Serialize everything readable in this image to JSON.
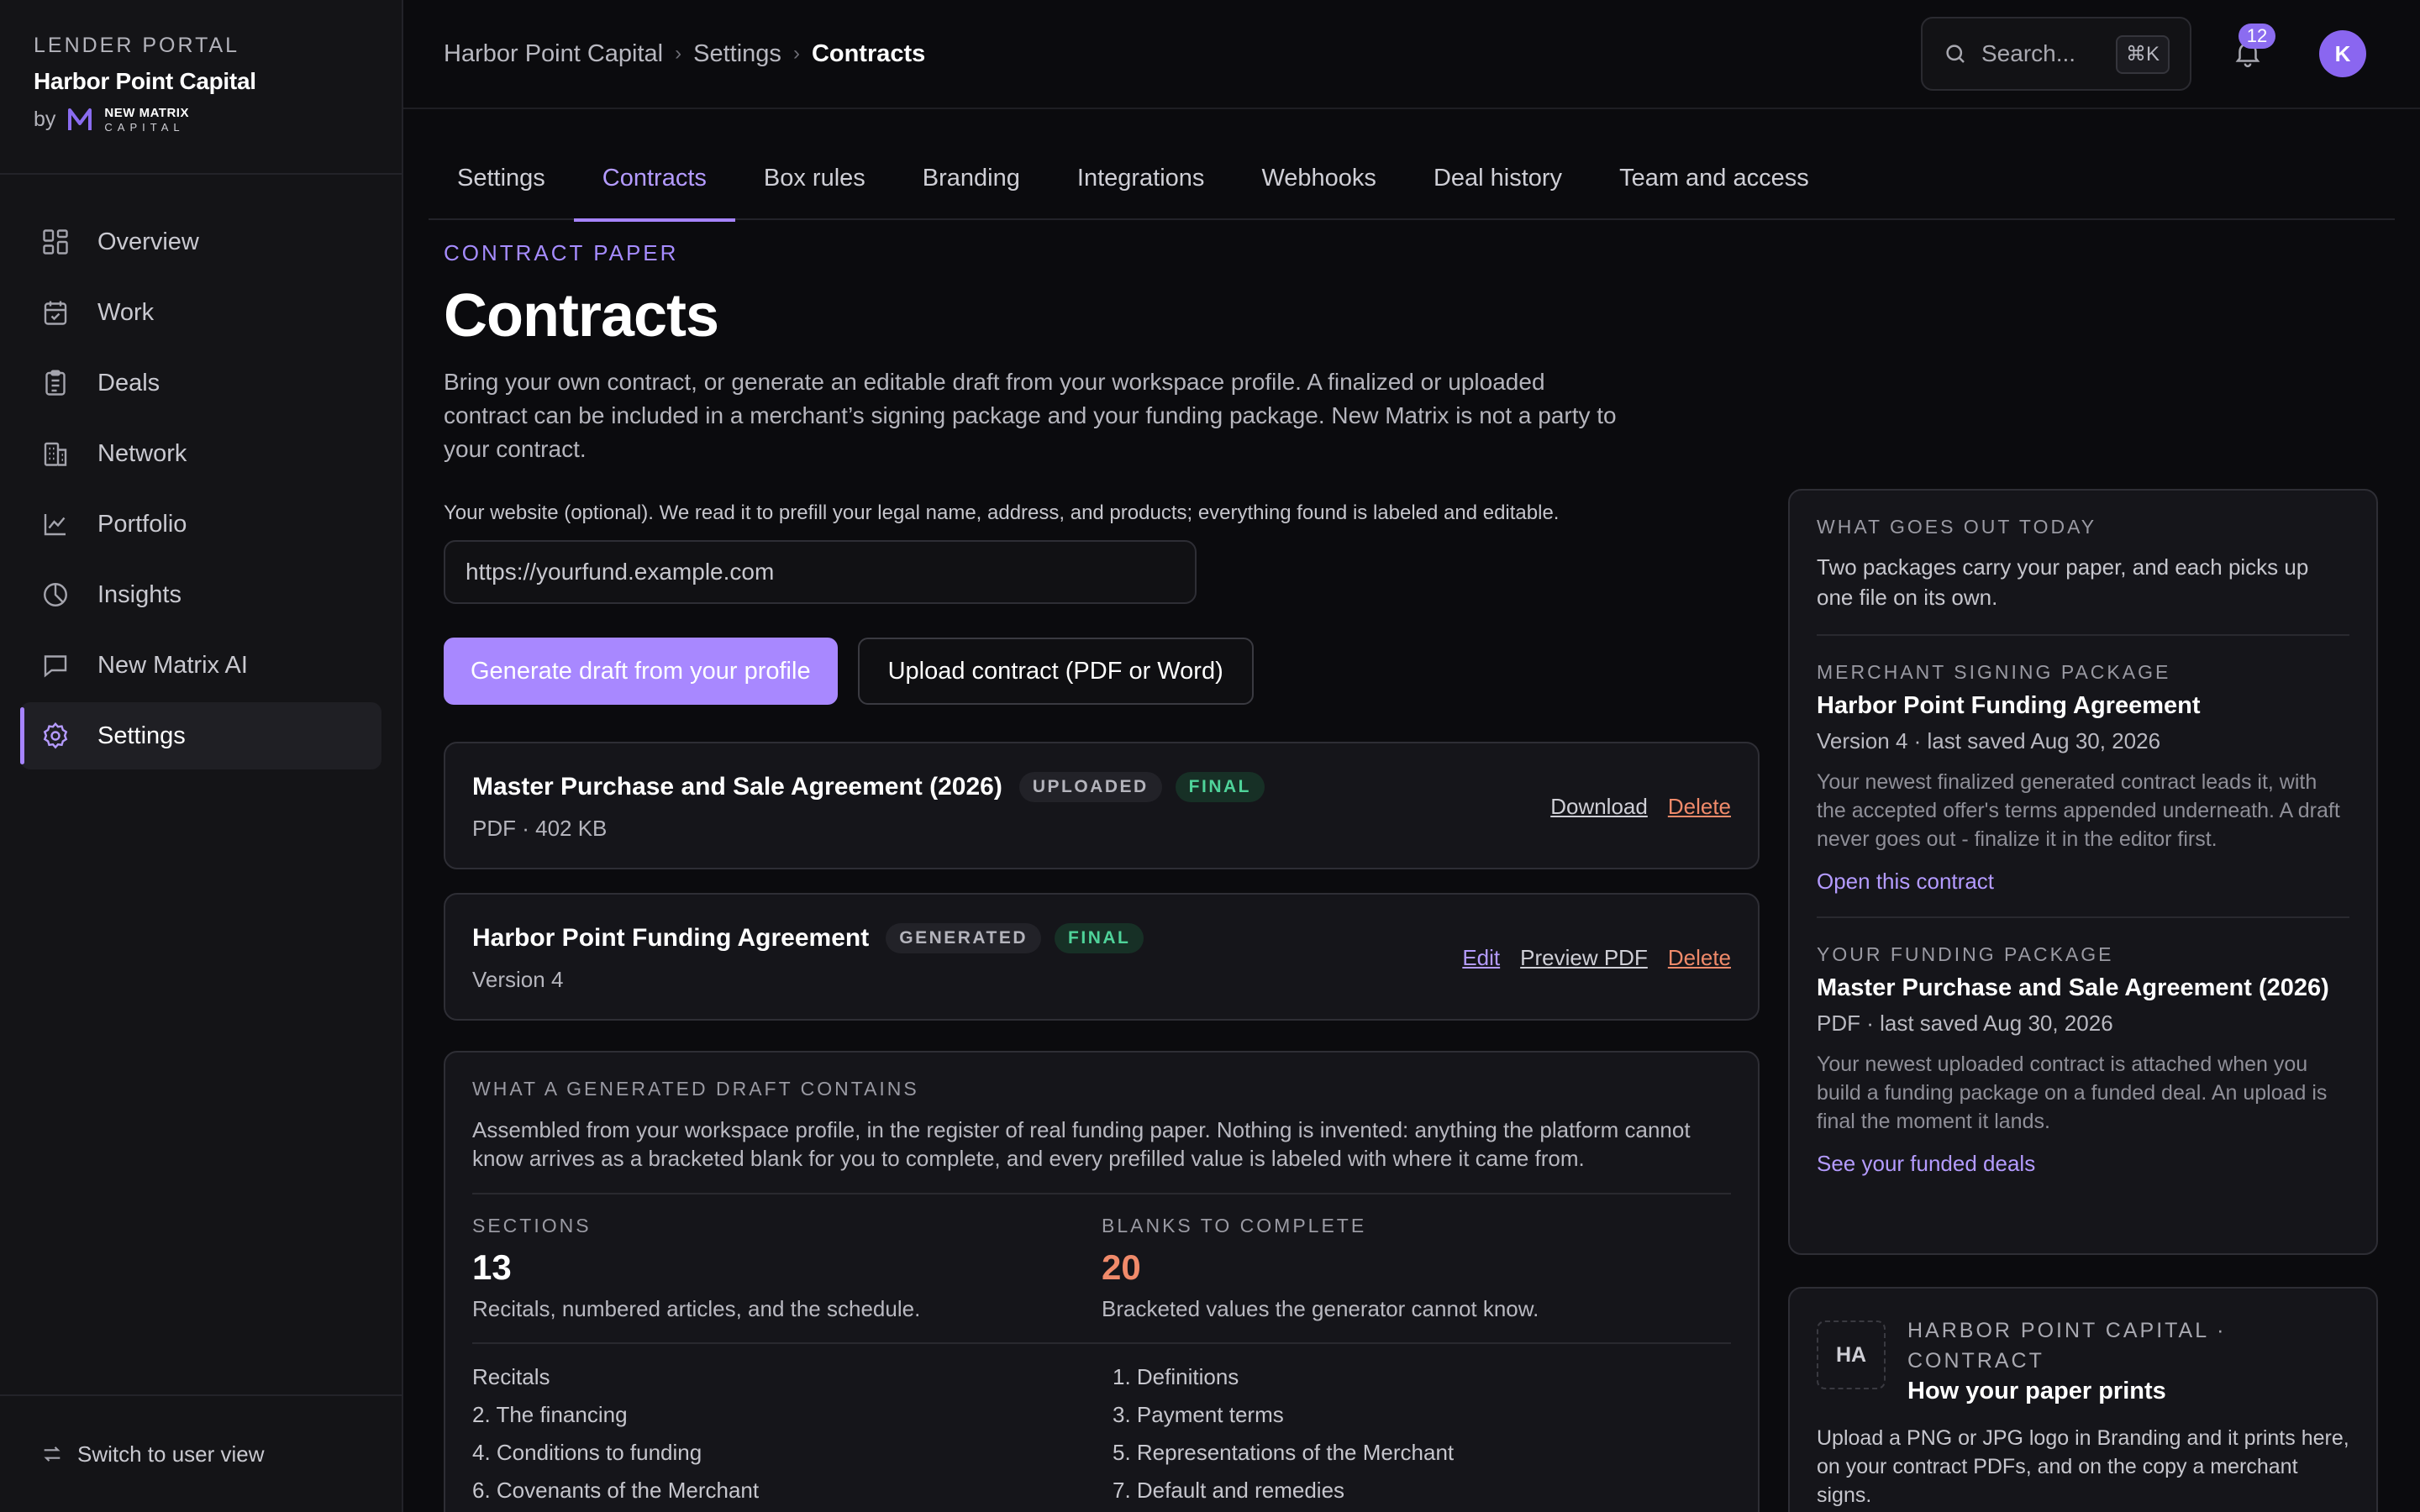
{
  "sidebar": {
    "kicker": "LENDER PORTAL",
    "company": "Harbor Point Capital",
    "by": "by",
    "partner_top": "NEW MATRIX",
    "partner_bottom": "CAPITAL",
    "items": [
      {
        "label": "Overview",
        "icon": "grid-icon"
      },
      {
        "label": "Work",
        "icon": "calendar-check-icon"
      },
      {
        "label": "Deals",
        "icon": "clipboard-icon"
      },
      {
        "label": "Network",
        "icon": "building-icon"
      },
      {
        "label": "Portfolio",
        "icon": "line-chart-icon"
      },
      {
        "label": "Insights",
        "icon": "pie-chart-icon"
      },
      {
        "label": "New Matrix AI",
        "icon": "chat-icon"
      },
      {
        "label": "Settings",
        "icon": "gear-icon",
        "active": true
      }
    ],
    "switch_label": "Switch to user view"
  },
  "topbar": {
    "breadcrumb": [
      "Harbor Point Capital",
      "Settings",
      "Contracts"
    ],
    "search_placeholder": "Search...",
    "search_shortcut": "⌘K",
    "notification_count": "12",
    "avatar_initial": "K"
  },
  "tabs": [
    {
      "label": "Settings"
    },
    {
      "label": "Contracts",
      "active": true
    },
    {
      "label": "Box rules"
    },
    {
      "label": "Branding"
    },
    {
      "label": "Integrations"
    },
    {
      "label": "Webhooks"
    },
    {
      "label": "Deal history"
    },
    {
      "label": "Team and access"
    }
  ],
  "main": {
    "kicker": "CONTRACT PAPER",
    "title": "Contracts",
    "lede": "Bring your own contract, or generate an editable draft from your workspace profile. A finalized or uploaded contract can be included in a merchant’s signing package and your funding package. New Matrix is not a party to your contract.",
    "website_label": "Your website (optional). We read it to prefill your legal name, address, and products; everything found is labeled and editable.",
    "website_placeholder": "https://yourfund.example.com",
    "generate_button": "Generate draft from your profile",
    "upload_button": "Upload contract (PDF or Word)",
    "contracts": [
      {
        "title": "Master Purchase and Sale Agreement (2026)",
        "source": "UPLOADED",
        "status": "FINAL",
        "meta": "PDF · 402 KB",
        "actions": [
          "Download",
          "Delete"
        ]
      },
      {
        "title": "Harbor Point Funding Agreement",
        "source": "GENERATED",
        "status": "FINAL",
        "meta": "Version 4",
        "actions": [
          "Edit",
          "Preview PDF",
          "Delete"
        ]
      }
    ],
    "draft": {
      "kicker": "WHAT A GENERATED DRAFT CONTAINS",
      "description": "Assembled from your workspace profile, in the register of real funding paper. Nothing is invented: anything the platform cannot know arrives as a bracketed blank for you to complete, and every prefilled value is labeled with where it came from.",
      "sections_label": "SECTIONS",
      "sections_value": "13",
      "sections_sub": "Recitals, numbered articles, and the schedule.",
      "blanks_label": "BLANKS TO COMPLETE",
      "blanks_value": "20",
      "blanks_sub": "Bracketed values the generator cannot know.",
      "section_list": [
        "Recitals",
        "1. Definitions",
        "2. The financing",
        "3. Payment terms",
        "4. Conditions to funding",
        "5. Representations of the Merchant",
        "6. Covenants of the Merchant",
        "7. Default and remedies"
      ]
    }
  },
  "rail": {
    "kicker": "WHAT GOES OUT TODAY",
    "description": "Two packages carry your paper, and each picks up one file on its own.",
    "merchant": {
      "kicker": "MERCHANT SIGNING PACKAGE",
      "title": "Harbor Point Funding Agreement",
      "meta": "Version 4 · last saved Aug 30, 2026",
      "body": "Your newest finalized generated contract leads it, with the accepted offer's terms appended underneath. A draft never goes out - finalize it in the editor first.",
      "link": "Open this contract"
    },
    "funding": {
      "kicker": "YOUR FUNDING PACKAGE",
      "title": "Master Purchase and Sale Agreement (2026)",
      "meta": "PDF · last saved Aug 30, 2026",
      "body": "Your newest uploaded contract is attached when you build a funding package on a funded deal. An upload is final the moment it lands.",
      "link": "See your funded deals"
    },
    "brand_card": {
      "initials": "HA",
      "kicker": "HARBOR POINT CAPITAL · CONTRACT",
      "title": "How your paper prints",
      "body": "Upload a PNG or JPG logo in Branding and it prints here, on your contract PDFs, and on the copy a merchant signs."
    }
  },
  "colors": {
    "accent": "#a684ff",
    "success": "#4fd39a",
    "danger": "#f08a6a",
    "background": "#0b0b0e"
  }
}
